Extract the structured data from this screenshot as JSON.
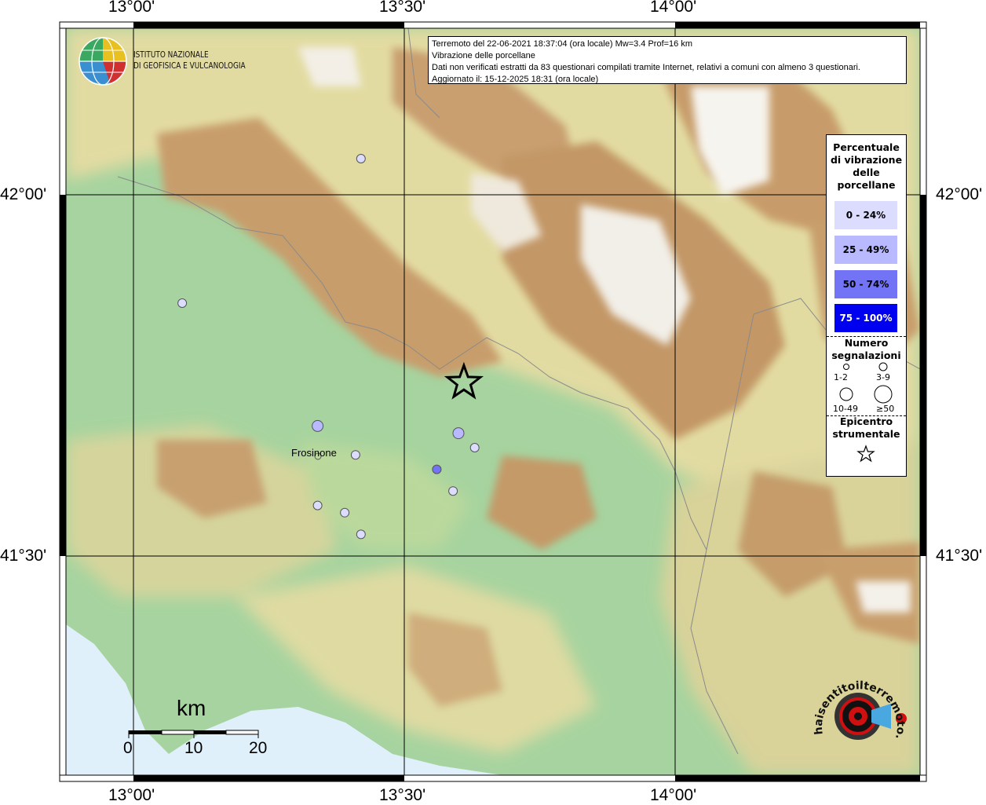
{
  "map": {
    "lat_ticks": [
      "42°00'",
      "41°30'"
    ],
    "lon_ticks": [
      "13°00'",
      "13°30'",
      "14°00'"
    ]
  },
  "header": {
    "line1": "Terremoto del 22-06-2021 18:37:04 (ora locale) Mw=3.4 Prof=16 km",
    "line2": "Vibrazione delle porcellane",
    "line3": "Dati non verificati estratti da 83 questionari compilati tramite Internet, relativi a comuni con almeno 3 questionari.",
    "line4": "Aggiornato il: 15-12-2025 18:31 (ora locale)"
  },
  "logo": {
    "line1": "ISTITUTO NAZIONALE",
    "line2": "DI GEOFISICA E VULCANOLOGIA"
  },
  "legend": {
    "title_lines": [
      "Percentuale",
      "di vibrazione",
      "delle",
      "porcellane"
    ],
    "classes": [
      {
        "label": "0 - 24%",
        "color": "#dcdcff",
        "text_color": "#000000"
      },
      {
        "label": "25 - 49%",
        "color": "#b9b9ff",
        "text_color": "#000000"
      },
      {
        "label": "50 - 74%",
        "color": "#7373f5",
        "text_color": "#000000"
      },
      {
        "label": "75 - 100%",
        "color": "#0000f0",
        "text_color": "#ffffff"
      }
    ],
    "count_title_lines": [
      "Numero",
      "segnalazioni"
    ],
    "count_labels": [
      "1-2",
      "3-9",
      "10-49",
      "≥50"
    ],
    "epicenter_title_lines": [
      "Epicentro",
      "strumentale"
    ]
  },
  "places": [
    {
      "name": "Frosinone"
    }
  ],
  "scale": {
    "unit": "km",
    "labels": [
      "0",
      "10",
      "20"
    ]
  },
  "observations": [
    {
      "lon": 13.42,
      "lat": 42.05,
      "class": 0,
      "count": "3-9"
    },
    {
      "lon": 13.09,
      "lat": 41.85,
      "class": 0,
      "count": "3-9"
    },
    {
      "lon": 13.34,
      "lat": 41.68,
      "class": 1,
      "count": "10-49"
    },
    {
      "lon": 13.41,
      "lat": 41.64,
      "class": 0,
      "count": "3-9"
    },
    {
      "lon": 13.34,
      "lat": 41.57,
      "class": 0,
      "count": "3-9"
    },
    {
      "lon": 13.39,
      "lat": 41.56,
      "class": 0,
      "count": "3-9"
    },
    {
      "lon": 13.42,
      "lat": 41.53,
      "class": 0,
      "count": "3-9"
    },
    {
      "lon": 13.6,
      "lat": 41.67,
      "class": 1,
      "count": "10-49"
    },
    {
      "lon": 13.63,
      "lat": 41.65,
      "class": 0,
      "count": "3-9"
    },
    {
      "lon": 13.56,
      "lat": 41.62,
      "class": 2,
      "count": "3-9"
    },
    {
      "lon": 13.59,
      "lat": 41.59,
      "class": 0,
      "count": "3-9"
    }
  ],
  "epicenter": {
    "lon": 13.61,
    "lat": 41.74
  },
  "colors": {
    "sea": "#dff0fa",
    "lowland": "#9fd09a",
    "hill": "#e8dfa8",
    "mountain": "#c8a070",
    "peak": "#ffffff"
  },
  "badge": {
    "text": "haisentitoilterremoto.it"
  }
}
